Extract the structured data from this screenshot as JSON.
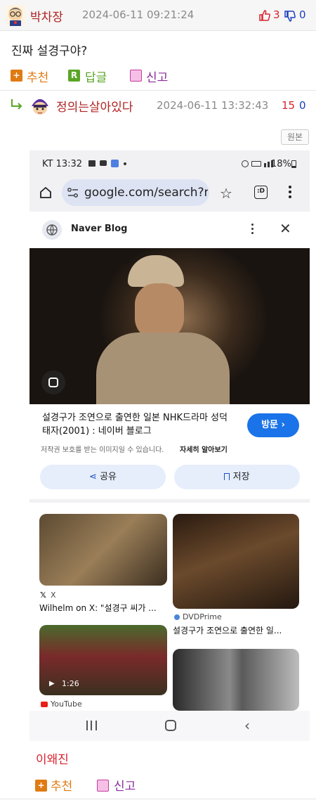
{
  "post": {
    "author": "박차장",
    "datetime": "2024-06-11 09:21:24",
    "likes": "3",
    "dislikes": "0",
    "body": "진짜 설경구야?",
    "actions": {
      "recommend": "추천",
      "reply": "답글",
      "report": "신고"
    }
  },
  "reply": {
    "author": "정의는살아있다",
    "datetime": "2024-06-11 13:32:43",
    "likes": "15",
    "dislikes": "0",
    "original_button": "원본",
    "signature": "이왜진",
    "actions": {
      "recommend": "추천",
      "report": "신고"
    }
  },
  "phone": {
    "status": {
      "carrier_time": "KT 13:32",
      "battery": "18%"
    },
    "url": "google.com/search?ne",
    "tab_count": ":D",
    "card": {
      "source": "Naver Blog",
      "title": "설경구가 조연으로 출연한 일본 NHK드라마 성덕태자(2001) : 네이버 블로그",
      "visit": "방문",
      "notice": "저작권 보호를 받는 이미지일 수 있습니다.",
      "learn_more": "자세히 알아보기",
      "share": "공유",
      "save": "저장"
    },
    "results": [
      {
        "source": "X",
        "title": "Wilhelm on X: \"설경구 씨가 ..."
      },
      {
        "source": "DVDPrime",
        "title": "설경구가 조연으로 출연한 일..."
      },
      {
        "source": "YouTube",
        "duration": "1:26"
      }
    ]
  },
  "colors": {
    "accent_red": "#d9232f",
    "accent_blue": "#1a3fbf",
    "author_red": "#b02222",
    "orange": "#e07a12",
    "green": "#5aa526",
    "google_blue": "#1a73e8"
  }
}
